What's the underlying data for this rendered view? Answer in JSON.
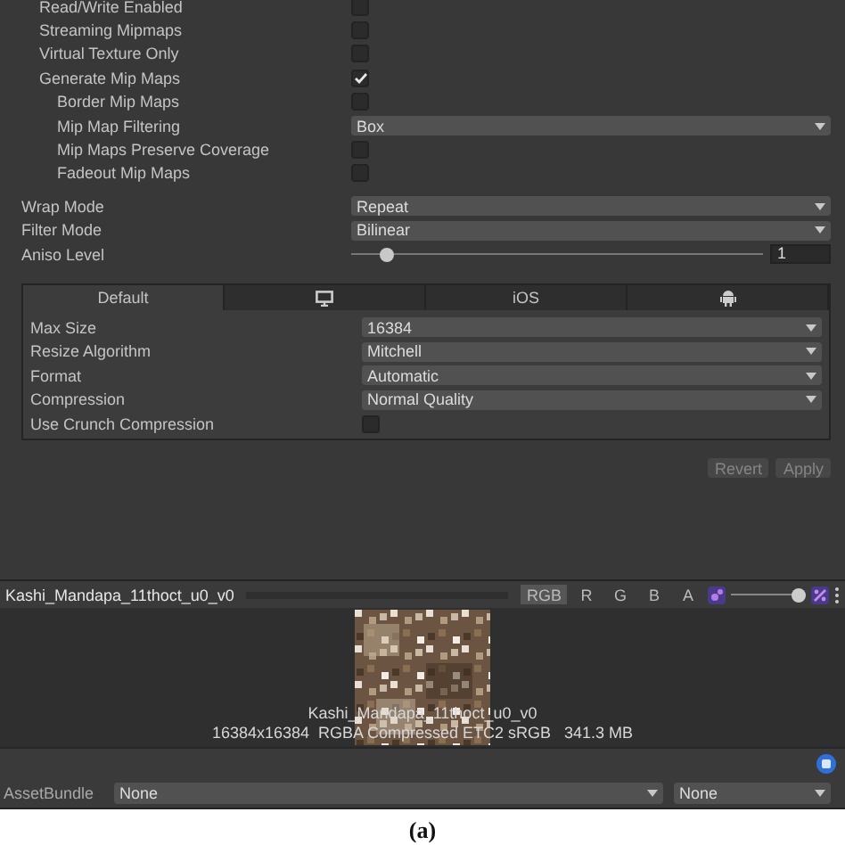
{
  "texture_options": [
    {
      "kind": "checkbox",
      "label": "Read/Write Enabled",
      "checked": false
    },
    {
      "kind": "checkbox",
      "label": "Streaming Mipmaps",
      "checked": false
    },
    {
      "kind": "checkbox",
      "label": "Virtual Texture Only",
      "checked": false
    },
    {
      "kind": "checkbox",
      "label": "Generate Mip Maps",
      "checked": true,
      "children": [
        {
          "kind": "checkbox",
          "label": "Border Mip Maps",
          "checked": false
        },
        {
          "kind": "dropdown",
          "label": "Mip Map Filtering",
          "value": "Box"
        },
        {
          "kind": "checkbox",
          "label": "Mip Maps Preserve Coverage",
          "checked": false
        },
        {
          "kind": "checkbox",
          "label": "Fadeout Mip Maps",
          "checked": false
        }
      ]
    }
  ],
  "sampling": [
    {
      "kind": "dropdown",
      "label": "Wrap Mode",
      "value": "Repeat"
    },
    {
      "kind": "dropdown",
      "label": "Filter Mode",
      "value": "Bilinear"
    },
    {
      "kind": "slider",
      "label": "Aniso Level",
      "level": 0.07,
      "reading": "1"
    }
  ],
  "platform_tabs": [
    {
      "kind": "text",
      "label": "Default",
      "selected": true
    },
    {
      "kind": "desktop",
      "selected": false
    },
    {
      "kind": "text",
      "label": "iOS",
      "selected": false
    },
    {
      "kind": "android",
      "selected": false
    }
  ],
  "platform_settings": [
    {
      "kind": "dropdown",
      "label": "Max Size",
      "value": "16384"
    },
    {
      "kind": "dropdown",
      "label": "Resize Algorithm",
      "value": "Mitchell"
    },
    {
      "kind": "dropdown",
      "label": "Format",
      "value": "Automatic"
    },
    {
      "kind": "dropdown",
      "label": "Compression",
      "value": "Normal Quality"
    },
    {
      "kind": "checkbox",
      "label": "Use Crunch Compression",
      "checked": false
    }
  ],
  "buttons": [
    {
      "label": "Revert",
      "disabled": true
    },
    {
      "label": "Apply",
      "disabled": true
    }
  ],
  "preview": {
    "title": "Kashi_Mandapa_11thoct_u0_v0",
    "channels": [
      {
        "label": "RGB",
        "selected": true
      },
      {
        "label": "R",
        "selected": false
      },
      {
        "label": "G",
        "selected": false
      },
      {
        "label": "B",
        "selected": false
      },
      {
        "label": "A",
        "selected": false
      }
    ],
    "mip_slider": {
      "level": 1.0
    },
    "image_name": "Kashi_Mandapa_11thoct_u0_v0",
    "image_info": "16384x16384  RGBA Compressed ETC2 sRGB   341.3 MB"
  },
  "asset_bundle": {
    "label": "AssetBundle",
    "name": "None",
    "variant": "None"
  },
  "caption": "(a)"
}
